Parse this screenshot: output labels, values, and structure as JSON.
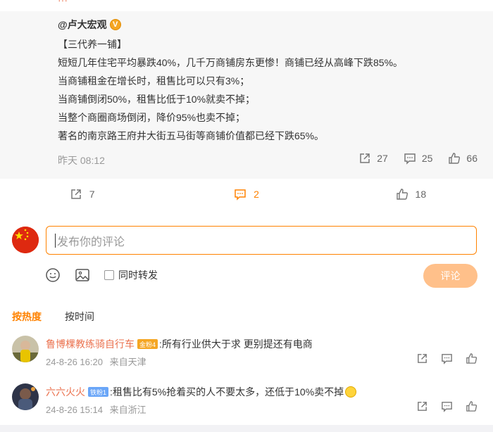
{
  "repost": {
    "author": "@卢大宏观",
    "verified_badge": "V",
    "lines": [
      "【三代养一铺】",
      "短短几年住宅平均暴跌40%，几千万商铺房东更惨！商铺已经从高峰下跌85%。",
      "当商铺租金在增长时，租售比可以只有3%；",
      "当商铺倒闭50%，租售比低于10%就卖不掉；",
      "当整个商圈商场倒闭，降价95%也卖不掉；",
      "著名的南京路王府井大街五马街等商铺价值都已经下跌65%。"
    ],
    "time": "昨天 08:12",
    "reposts": "27",
    "comments": "25",
    "likes": "66"
  },
  "actions": {
    "repost_count": "7",
    "comment_count": "2",
    "like_count": "18"
  },
  "composer": {
    "placeholder": "发布你的评论",
    "also_repost_label": "同时转发",
    "submit_label": "评论"
  },
  "sort": {
    "hot_label": "按热度",
    "time_label": "按时间"
  },
  "comments": [
    {
      "name": "鲁博棵教练骑自行车",
      "badge": "金粉4",
      "badge_color": "#f5a623",
      "text": ":所有行业供大于求 更别提还有电商",
      "date": "24-8-26 16:20",
      "location": "来自天津"
    },
    {
      "name": "六六火火",
      "badge": "铁粉1",
      "badge_color": "#6aa6f8",
      "text": ":租售比有5%抢着买的人不要太多，还低于10%卖不掉",
      "date": "24-8-26 15:14",
      "location": "来自浙江"
    }
  ],
  "colors": {
    "accent": "#ff8200",
    "name": "#eb7350"
  }
}
